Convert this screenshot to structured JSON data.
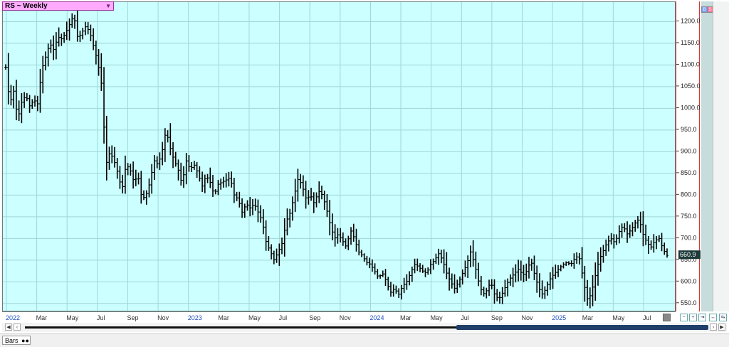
{
  "chart_title": "RS ~ Weekly",
  "status_bar": {
    "tab_label": "Bars"
  },
  "corner_buttons": [
    "B",
    "S"
  ],
  "last_price_label": "660.9",
  "chart_data": {
    "type": "bar",
    "subtype": "ohlc",
    "symbol": "RS",
    "interval": "Weekly",
    "ylim": [
      530,
      1245
    ],
    "y_ticks": [
      550.0,
      600.0,
      650.0,
      700.0,
      750.0,
      800.0,
      850.0,
      900.0,
      950.0,
      1000.0,
      1050.0,
      1100.0,
      1150.0,
      1200.0
    ],
    "x_labels": [
      {
        "label": "2022",
        "year": true
      },
      {
        "label": "Mar",
        "year": false
      },
      {
        "label": "May",
        "year": false
      },
      {
        "label": "Jul",
        "year": false
      },
      {
        "label": "Sep",
        "year": false
      },
      {
        "label": "Nov",
        "year": false
      },
      {
        "label": "2023",
        "year": true
      },
      {
        "label": "Mar",
        "year": false
      },
      {
        "label": "May",
        "year": false
      },
      {
        "label": "Jul",
        "year": false
      },
      {
        "label": "Sep",
        "year": false
      },
      {
        "label": "Nov",
        "year": false
      },
      {
        "label": "2024",
        "year": true
      },
      {
        "label": "Mar",
        "year": false
      },
      {
        "label": "May",
        "year": false
      },
      {
        "label": "Jul",
        "year": false
      },
      {
        "label": "Sep",
        "year": false
      },
      {
        "label": "Nov",
        "year": false
      },
      {
        "label": "2025",
        "year": true
      },
      {
        "label": "Mar",
        "year": false
      },
      {
        "label": "May",
        "year": false
      },
      {
        "label": "Jul",
        "year": false
      }
    ],
    "last_value": 660.9,
    "close_path": [
      1095,
      1010,
      1040,
      975,
      1015,
      1030,
      1005,
      1020,
      1010,
      1090,
      1120,
      1150,
      1135,
      1165,
      1160,
      1175,
      1195,
      1215,
      1160,
      1175,
      1190,
      1175,
      1140,
      1105,
      1050,
      870,
      900,
      880,
      850,
      810,
      870,
      860,
      830,
      845,
      790,
      800,
      830,
      880,
      870,
      900,
      950,
      910,
      880,
      860,
      825,
      880,
      860,
      870,
      850,
      820,
      845,
      830,
      800,
      825,
      830,
      835,
      840,
      800,
      790,
      760,
      780,
      770,
      780,
      760,
      740,
      690,
      670,
      650,
      670,
      690,
      740,
      760,
      800,
      840,
      820,
      790,
      800,
      780,
      810,
      800,
      770,
      730,
      700,
      710,
      695,
      680,
      720,
      700,
      670,
      660,
      645,
      640,
      625,
      610,
      620,
      600,
      575,
      585,
      570,
      590,
      600,
      620,
      640,
      635,
      625,
      620,
      640,
      650,
      665,
      650,
      620,
      600,
      585,
      600,
      620,
      640,
      670,
      640,
      600,
      570,
      580,
      600,
      570,
      560,
      575,
      595,
      610,
      620,
      630,
      615,
      625,
      650,
      615,
      585,
      570,
      590,
      610,
      620,
      630,
      640,
      645,
      640,
      655,
      660,
      610,
      560,
      570,
      610,
      650,
      670,
      690,
      700,
      690,
      715,
      730,
      710,
      720,
      735,
      745,
      710,
      690,
      680,
      695,
      700,
      675,
      660.9
    ]
  }
}
